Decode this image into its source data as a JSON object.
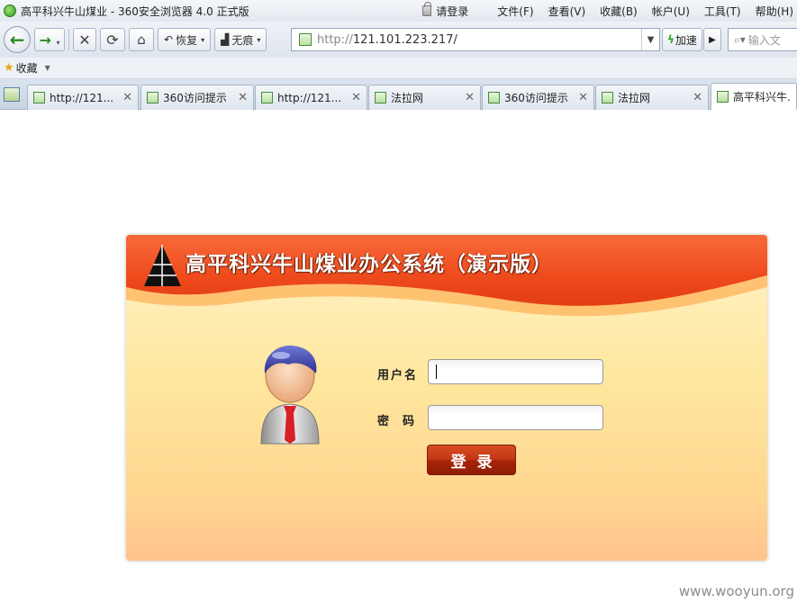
{
  "window": {
    "title": "高平科兴牛山煤业 - 360安全浏览器 4.0 正式版",
    "login_link": "请登录",
    "menus": [
      "文件(F)",
      "查看(V)",
      "收藏(B)",
      "帐户(U)",
      "工具(T)",
      "帮助(H)"
    ]
  },
  "toolbar": {
    "restore_label": "恢复",
    "incognito_label": "无痕",
    "url_protocol": "http://",
    "url_host": "121.101.223.217/",
    "speed_label": "加速",
    "search_placeholder": "输入文"
  },
  "favorites": {
    "label": "收藏"
  },
  "tabs": [
    {
      "label": "http://121..."
    },
    {
      "label": "360访问提示"
    },
    {
      "label": "http://121..."
    },
    {
      "label": "法拉网"
    },
    {
      "label": "360访问提示"
    },
    {
      "label": "法拉网"
    },
    {
      "label": "高平科兴牛..."
    }
  ],
  "login": {
    "system_title": "高平科兴牛山煤业办公系统（演示版）",
    "username_label": "用户名",
    "password_label": "密  码",
    "username_value": "",
    "password_value": "",
    "submit_label": "登录"
  },
  "watermark": "www.wooyun.org",
  "colors": {
    "banner_red": "#ee4a1c",
    "panel_yellow": "#ffe79e",
    "button_red": "#b8300f"
  }
}
